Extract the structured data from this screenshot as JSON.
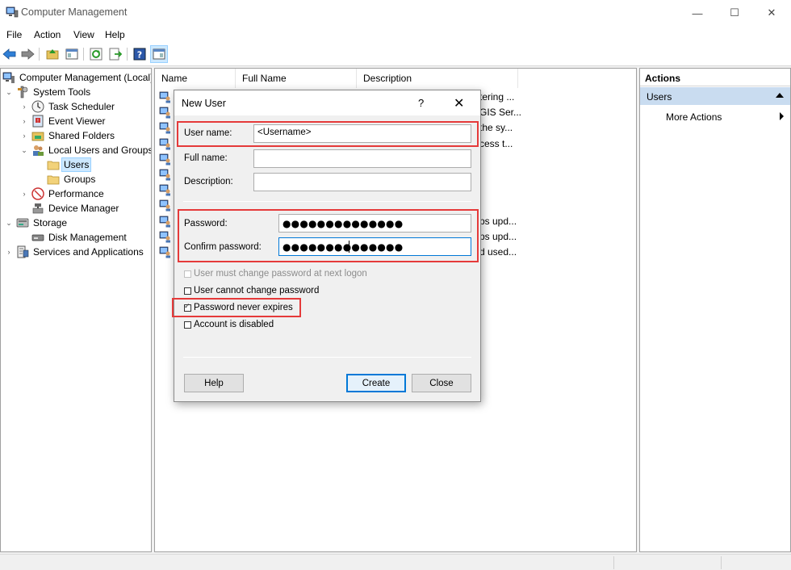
{
  "window": {
    "title": "Computer Management",
    "minimize": "—",
    "maximize": "☐",
    "close": "✕"
  },
  "menu": [
    "File",
    "Action",
    "View",
    "Help"
  ],
  "tree": {
    "root": "Computer Management (Local)",
    "system_tools": "System Tools",
    "task_scheduler": "Task Scheduler",
    "event_viewer": "Event Viewer",
    "shared_folders": "Shared Folders",
    "local_users_groups": "Local Users and Groups",
    "users": "Users",
    "groups": "Groups",
    "performance": "Performance",
    "device_manager": "Device Manager",
    "storage": "Storage",
    "disk_management": "Disk Management",
    "services_apps": "Services and Applications"
  },
  "list": {
    "columns": [
      "Name",
      "Full Name",
      "Description"
    ],
    "rows": [
      {
        "description": "tering ..."
      },
      {
        "description": "GIS Ser..."
      },
      {
        "description": "the sy..."
      },
      {
        "description": "cess t..."
      },
      {
        "description": ""
      },
      {
        "description": ""
      },
      {
        "description": ""
      },
      {
        "description": ""
      },
      {
        "description": "ps upd..."
      },
      {
        "description": "ps upd..."
      },
      {
        "description": "d used..."
      }
    ]
  },
  "actions": {
    "header": "Actions",
    "section": "Users",
    "more": "More Actions"
  },
  "dialog": {
    "title": "New User",
    "help_glyph": "?",
    "close_glyph": "✕",
    "username_label": "User name:",
    "username_value": "<Username>",
    "fullname_label": "Full name:",
    "fullname_value": "",
    "description_label": "Description:",
    "description_value": "",
    "password_label": "Password:",
    "password_dots": "●●●●●●●●●●●●●●",
    "confirm_label": "Confirm password:",
    "confirm_dots": "●●●●●●●●●●●●●●",
    "checkboxes": [
      {
        "label": "User must change password at next logon",
        "checked": false,
        "disabled": true
      },
      {
        "label": "User cannot change password",
        "checked": false,
        "disabled": false
      },
      {
        "label": "Password never expires",
        "checked": true,
        "disabled": false
      },
      {
        "label": "Account is disabled",
        "checked": false,
        "disabled": false
      }
    ],
    "help_button": "Help",
    "create_button": "Create",
    "close_button": "Close"
  },
  "colors": {
    "highlight": "#e53a3a",
    "selection": "#cce8ff",
    "accent": "#0078d7",
    "actions_section": "#c9dcf0"
  }
}
